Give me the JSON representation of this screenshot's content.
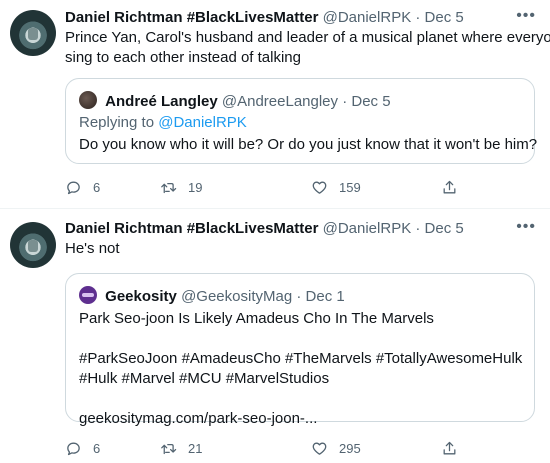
{
  "tweets": [
    {
      "author": "Daniel Richtman #BlackLivesMatter",
      "handle": "@DanielRPK",
      "separator": "·",
      "date": "Dec 5",
      "more": "•••",
      "text_lines": [
        "Prince Yan, Carol's husband and leader of a musical planet where everyone",
        "sing to each other instead of talking"
      ],
      "quote": {
        "author": "Andreé Langley",
        "handle": "@AndreeLangley",
        "separator": "·",
        "date": "Dec 5",
        "reply_prefix": "Replying to ",
        "reply_to": "@DanielRPK",
        "lines": [
          "Do you know who it will be? Or do you just know that it won't be him?"
        ]
      },
      "actions": {
        "replies": "6",
        "retweets": "19",
        "likes": "159"
      }
    },
    {
      "author": "Daniel Richtman #BlackLivesMatter",
      "handle": "@DanielRPK",
      "separator": "·",
      "date": "Dec 5",
      "more": "•••",
      "text_lines": [
        "He's not"
      ],
      "quote": {
        "author": "Geekosity",
        "handle": "@GeekosityMag",
        "separator": "·",
        "date": "Dec 1",
        "lines": [
          "Park Seo-joon Is Likely Amadeus Cho In The Marvels",
          "",
          "#ParkSeoJoon #AmadeusCho #TheMarvels #TotallyAwesomeHulk",
          "#Hulk #Marvel #MCU #MarvelStudios",
          "",
          "geekositymag.com/park-seo-joon-..."
        ]
      },
      "actions": {
        "replies": "6",
        "retweets": "21",
        "likes": "295"
      }
    }
  ],
  "icons": {
    "reply": "reply-icon",
    "retweet": "retweet-icon",
    "like": "heart-icon",
    "share": "share-icon"
  },
  "colors": {
    "text": "#0f1419",
    "secondary": "#536471",
    "link": "#1d9bf0",
    "border": "#cfd9de"
  }
}
